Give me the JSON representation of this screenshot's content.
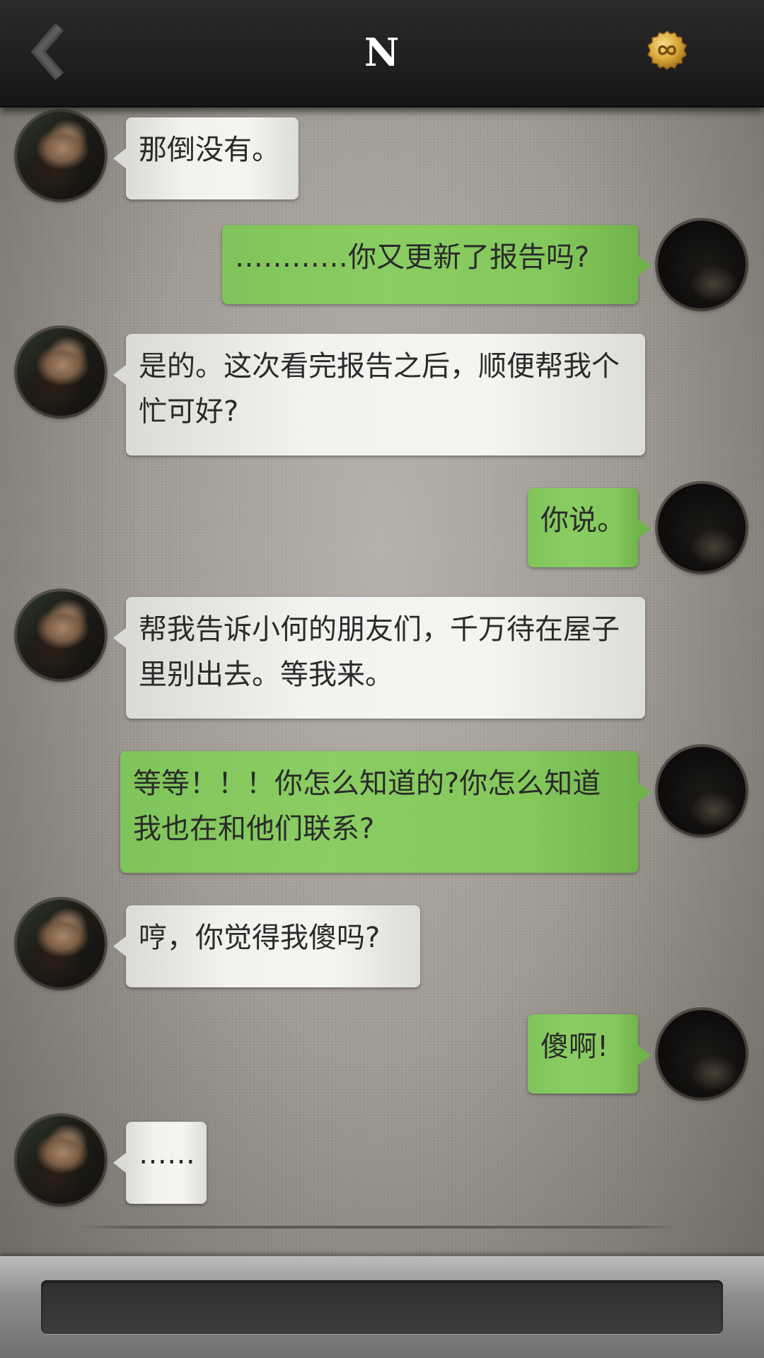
{
  "header": {
    "title": "N",
    "back_icon": "chevron-left-icon",
    "badge_icon": "infinity-coin-icon",
    "badge_color": "#d9a83a"
  },
  "messages": [
    {
      "side": "left",
      "text": "那倒没有。"
    },
    {
      "side": "right",
      "text": "…………你又更新了报告吗?"
    },
    {
      "side": "left",
      "text": "是的。这次看完报告之后，顺便帮我个忙可好?"
    },
    {
      "side": "right",
      "text": "你说。"
    },
    {
      "side": "left",
      "text": "帮我告诉小何的朋友们，千万待在屋子里别出去。等我来。"
    },
    {
      "side": "right",
      "text": "等等！！！你怎么知道的?你怎么知道我也在和他们联系?"
    },
    {
      "side": "left",
      "text": "哼，你觉得我傻吗?"
    },
    {
      "side": "right",
      "text": "傻啊!"
    },
    {
      "side": "left",
      "text": "……"
    }
  ],
  "colors": {
    "incoming_bubble": "#f2f2ef",
    "outgoing_bubble": "#8acd63",
    "top_bar": "#1d1d1d"
  },
  "input": {
    "value": "",
    "placeholder": ""
  }
}
